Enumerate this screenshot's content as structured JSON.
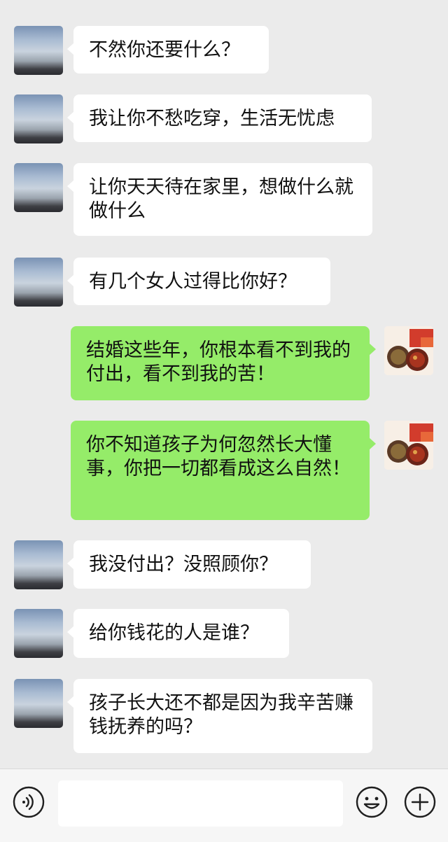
{
  "messages": [
    {
      "side": "in",
      "text": "不然你还要什么？"
    },
    {
      "side": "in",
      "text": "我让你不愁吃穿，生活无忧虑"
    },
    {
      "side": "in",
      "text": "让你天天待在家里，想做什么就做什么"
    },
    {
      "side": "in",
      "text": "有几个女人过得比你好？"
    },
    {
      "side": "out",
      "text": "结婚这些年，你根本看不到我的付出，看不到我的苦！"
    },
    {
      "side": "out",
      "text": "你不知道孩子为何忽然长大懂事，你把一切都看成这么自然！"
    },
    {
      "side": "in",
      "text": "我没付出？没照顾你？"
    },
    {
      "side": "in",
      "text": "给你钱花的人是谁？"
    },
    {
      "side": "in",
      "text": "孩子长大还不都是因为我辛苦赚钱抚养的吗？"
    }
  ],
  "input_bar": {
    "voice_icon": "voice-icon",
    "emoji_icon": "emoji-icon",
    "plus_icon": "plus-icon",
    "input_value": ""
  },
  "colors": {
    "background": "#ebebeb",
    "incoming_bubble": "#ffffff",
    "outgoing_bubble": "#95ec69"
  }
}
